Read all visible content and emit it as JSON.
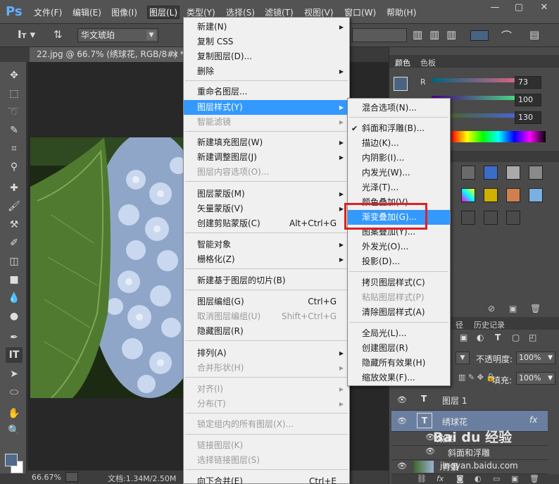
{
  "app": {
    "logo": "Ps"
  },
  "menubar": {
    "items": [
      {
        "label": "文件(F)"
      },
      {
        "label": "编辑(E)"
      },
      {
        "label": "图像(I)"
      },
      {
        "label": "图层(L)"
      },
      {
        "label": "类型(Y)"
      },
      {
        "label": "选择(S)"
      },
      {
        "label": "滤镜(T)"
      },
      {
        "label": "视图(V)"
      },
      {
        "label": "窗口(W)"
      },
      {
        "label": "帮助(H)"
      }
    ],
    "window_controls": [
      "—",
      "▢",
      "✕"
    ]
  },
  "options": {
    "font_family": "华文琥珀"
  },
  "document": {
    "tab_title": "22.jpg @ 66.7% (绣球花, RGB/8#) *"
  },
  "status": {
    "zoom": "66.67%",
    "doc_info": "文档:1.34M/2.50M"
  },
  "layer_menu": {
    "items": [
      {
        "label": "新建(N)",
        "sub": true,
        "disabled": false
      },
      {
        "label": "复制 CSS",
        "disabled": false
      },
      {
        "label": "复制图层(D)...",
        "disabled": false
      },
      {
        "label": "删除",
        "sub": true,
        "disabled": false
      },
      {
        "label": "重命名图层...",
        "disabled": false
      },
      {
        "label": "图层样式(Y)",
        "sub": true,
        "highlighted": true
      },
      {
        "label": "智能滤镜",
        "sub": true,
        "disabled": true
      },
      {
        "label": "新建填充图层(W)",
        "sub": true
      },
      {
        "label": "新建调整图层(J)",
        "sub": true
      },
      {
        "label": "图层内容选项(O)...",
        "disabled": true
      },
      {
        "label": "图层蒙版(M)",
        "sub": true
      },
      {
        "label": "矢量蒙版(V)",
        "sub": true
      },
      {
        "label": "创建剪贴蒙版(C)",
        "shortcut": "Alt+Ctrl+G"
      },
      {
        "label": "智能对象",
        "sub": true
      },
      {
        "label": "栅格化(Z)",
        "sub": true
      },
      {
        "label": "新建基于图层的切片(B)"
      },
      {
        "label": "图层编组(G)",
        "shortcut": "Ctrl+G"
      },
      {
        "label": "取消图层编组(U)",
        "shortcut": "Shift+Ctrl+G",
        "disabled": true
      },
      {
        "label": "隐藏图层(R)"
      },
      {
        "label": "排列(A)",
        "sub": true
      },
      {
        "label": "合并形状(H)",
        "sub": true,
        "disabled": true
      },
      {
        "label": "对齐(I)",
        "sub": true,
        "disabled": true
      },
      {
        "label": "分布(T)",
        "sub": true,
        "disabled": true
      },
      {
        "label": "锁定组内的所有图层(X)...",
        "disabled": true
      },
      {
        "label": "链接图层(K)",
        "disabled": true
      },
      {
        "label": "选择链接图层(S)",
        "disabled": true
      },
      {
        "label": "向下合并(E)",
        "shortcut": "Ctrl+E"
      }
    ]
  },
  "style_submenu": {
    "items": [
      {
        "label": "混合选项(N)..."
      },
      {
        "label": "斜面和浮雕(B)...",
        "checked": true
      },
      {
        "label": "描边(K)..."
      },
      {
        "label": "内阴影(I)..."
      },
      {
        "label": "内发光(W)..."
      },
      {
        "label": "光泽(T)..."
      },
      {
        "label": "颜色叠加(V)..."
      },
      {
        "label": "渐变叠加(G)...",
        "highlighted": true
      },
      {
        "label": "图案叠加(Y)..."
      },
      {
        "label": "外发光(O)..."
      },
      {
        "label": "投影(D)..."
      },
      {
        "label": "拷贝图层样式(C)"
      },
      {
        "label": "粘贴图层样式(P)",
        "disabled": true
      },
      {
        "label": "清除图层样式(A)"
      },
      {
        "label": "全局光(L)..."
      },
      {
        "label": "创建图层(R)"
      },
      {
        "label": "隐藏所有效果(H)"
      },
      {
        "label": "缩放效果(F)..."
      }
    ]
  },
  "color_panel": {
    "tabs": [
      "颜色",
      "色板"
    ],
    "r_label": "R",
    "r": "73",
    "g": "100",
    "b": "130",
    "fg_color": "#496482"
  },
  "layers_panel": {
    "tabs": [
      "径",
      "历史记录"
    ],
    "opacity_label": "不透明度:",
    "opacity": "100%",
    "fill_label": "填充:",
    "fill": "100%",
    "layers": [
      {
        "name": "图层 1",
        "type": "text"
      },
      {
        "name": "绣球花",
        "type": "text",
        "selected": true,
        "fx": "fx"
      },
      {
        "name": "效果",
        "type": "effects"
      },
      {
        "name": "斜面和浮雕",
        "type": "effect"
      },
      {
        "name": "背景",
        "type": "image"
      }
    ]
  },
  "watermark": {
    "brand": "Bai du 经验",
    "url": "jingyan.baidu.com"
  }
}
